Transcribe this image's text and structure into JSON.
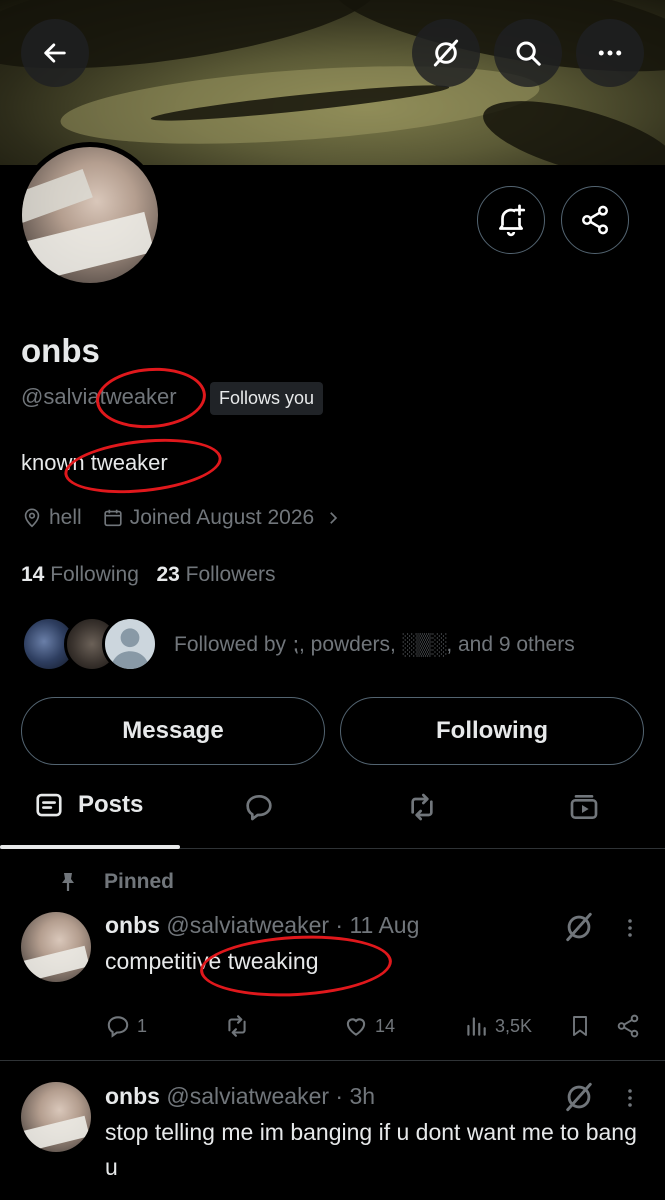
{
  "nav": {
    "back_icon": "arrow-left-icon",
    "grok_icon": "grok-slash-icon",
    "search_icon": "search-icon",
    "more_icon": "more-horizontal-icon"
  },
  "profile": {
    "name": "onbs",
    "handle": "@salviatweaker",
    "follows_you": "Follows you",
    "bio": "known tweaker",
    "location": "hell",
    "joined": "Joined August 2026",
    "following_count": "14",
    "following_label": "Following",
    "followers_count": "23",
    "followers_label": "Followers",
    "followed_by": "Followed by ⁏, powders, ░▒░, and 9 others"
  },
  "buttons": {
    "message": "Message",
    "following": "Following"
  },
  "tabs": {
    "posts": "Posts"
  },
  "posts": [
    {
      "pinned_label": "Pinned",
      "name": "onbs",
      "meta": "@salviatweaker · 11 Aug",
      "text": "competitive tweaking",
      "replies": "1",
      "likes": "14",
      "views": "3,5K"
    },
    {
      "name": "onbs",
      "meta": "@salviatweaker · 3h",
      "text": "stop telling me im banging if u dont want me to bang u"
    }
  ],
  "colors": {
    "background": "#000000",
    "text": "#e7e9ea",
    "muted": "#71767b",
    "border": "#536471",
    "annotation_red": "#e0181c"
  }
}
